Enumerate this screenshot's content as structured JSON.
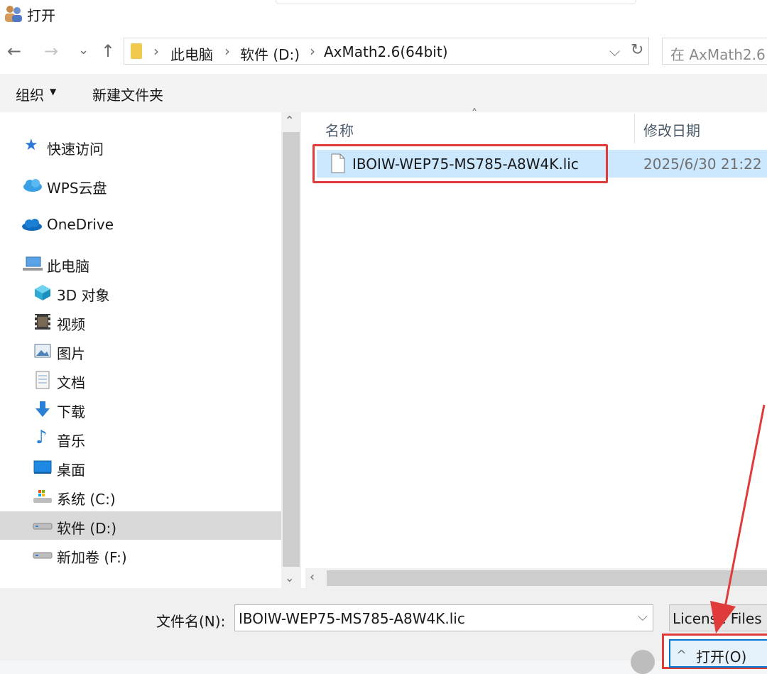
{
  "window": {
    "title": "打开"
  },
  "breadcrumb": [
    "此电脑",
    "软件 (D:)",
    "AxMath2.6(64bit)"
  ],
  "search": {
    "placeholder": "在 AxMath2.6"
  },
  "toolbar": {
    "organize": "组织",
    "new_folder": "新建文件夹"
  },
  "sidebar": {
    "quick_access": "快速访问",
    "wps": "WPS云盘",
    "onedrive": "OneDrive",
    "this_pc": "此电脑",
    "items": [
      "3D 对象",
      "视频",
      "图片",
      "文档",
      "下载",
      "音乐",
      "桌面",
      "系统 (C:)",
      "软件 (D:)",
      "新加卷 (F:)"
    ]
  },
  "columns": {
    "name": "名称",
    "modified": "修改日期"
  },
  "files": [
    {
      "name": "IBOIW-WEP75-MS785-A8W4K.lic",
      "modified": "2025/6/30 21:22"
    }
  ],
  "bottom": {
    "filename_label": "文件名(N):",
    "filename_value": "IBOIW-WEP75-MS785-A8W4K.lic",
    "filter": "License Files (",
    "open": "打开(O)"
  },
  "colors": {
    "selection": "#cce8ff",
    "annotation": "#e03b3b",
    "accent": "#0078d4"
  }
}
